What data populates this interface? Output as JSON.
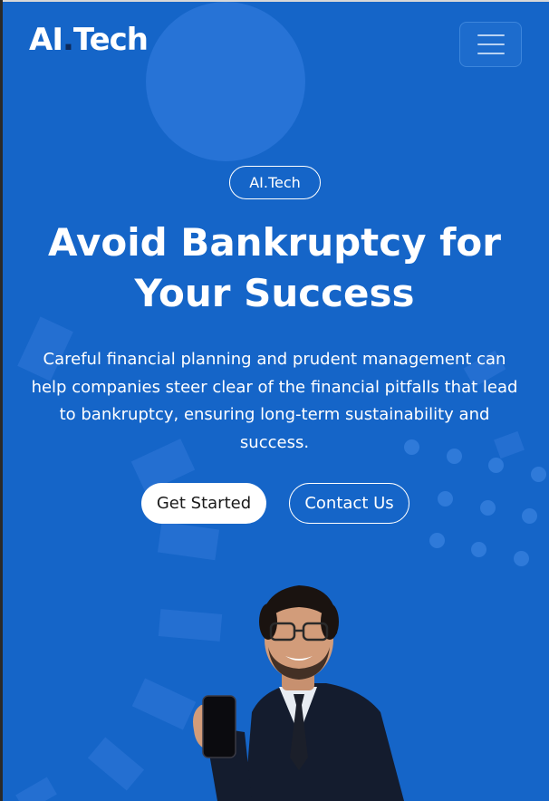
{
  "brand": {
    "name_part1": "AI",
    "name_dot": ".",
    "name_part2": "Tech"
  },
  "nav": {
    "menu_icon": "hamburger-menu-icon"
  },
  "hero": {
    "badge": "AI.Tech",
    "headline": "Avoid Bankruptcy for Your Success",
    "subtext": "Careful financial planning and prudent management can help companies steer clear of the financial pitfalls that lead to bankruptcy, ensuring long-term sustainability and success.",
    "primary_button": "Get Started",
    "secondary_button": "Contact Us"
  },
  "colors": {
    "background": "#1565c8",
    "accent_dark": "#0d2a5c",
    "text": "#ffffff",
    "button_primary_bg": "#ffffff"
  }
}
